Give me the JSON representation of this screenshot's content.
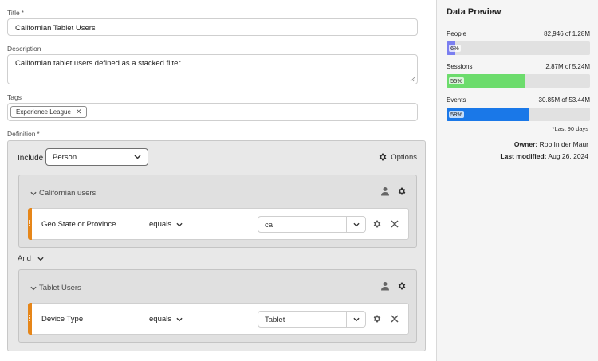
{
  "form": {
    "title_label": "Title",
    "title_value": "Californian Tablet Users",
    "description_label": "Description",
    "description_value": "Californian tablet users defined as a stacked filter.",
    "tags_label": "Tags",
    "tags": [
      "Experience League"
    ],
    "definition_label": "Definition",
    "required_mark": "*"
  },
  "definition": {
    "include_label": "Include",
    "include_value": "Person",
    "options_label": "Options",
    "and_label": "And",
    "containers": [
      {
        "name": "Californian users",
        "rule": {
          "dimension": "Geo State or Province",
          "operator": "equals",
          "value": "ca"
        }
      },
      {
        "name": "Tablet Users",
        "rule": {
          "dimension": "Device Type",
          "operator": "equals",
          "value": "Tablet"
        }
      }
    ]
  },
  "preview": {
    "title": "Data Preview",
    "metrics": [
      {
        "label": "People",
        "value": "82,946 of 1.28M",
        "pct_label": "6%",
        "pct": 6,
        "color": "#7b7ff0"
      },
      {
        "label": "Sessions",
        "value": "2.87M of 5.24M",
        "pct_label": "55%",
        "pct": 55,
        "color": "#6cdc6c"
      },
      {
        "label": "Events",
        "value": "30.85M of 53.44M",
        "pct_label": "58%",
        "pct": 58,
        "color": "#1a78e8"
      }
    ],
    "footnote": "*Last 90 days",
    "owner_label": "Owner:",
    "owner_value": "Rob In der Maur",
    "modified_label": "Last modified:",
    "modified_value": "Aug 26, 2024"
  }
}
